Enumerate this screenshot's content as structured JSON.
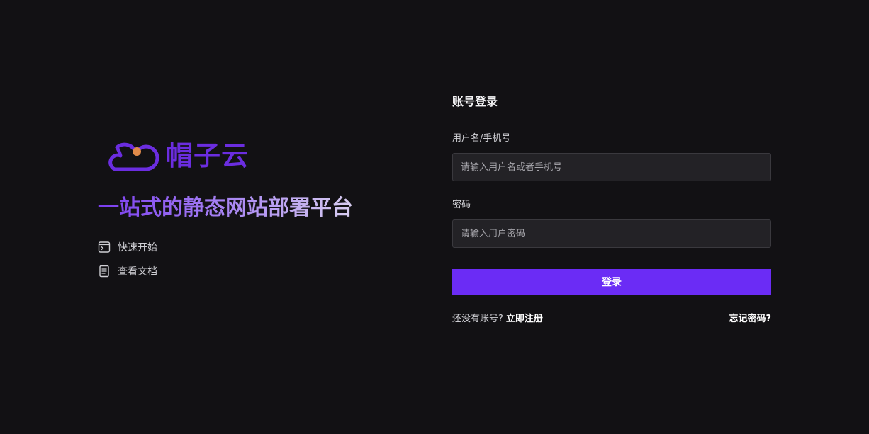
{
  "brand": {
    "logo_text": "帽子云",
    "slogan": "一站式的静态网站部署平台",
    "links": [
      {
        "label": "快速开始",
        "icon": "terminal-icon"
      },
      {
        "label": "查看文档",
        "icon": "document-icon"
      }
    ],
    "colors": {
      "logo": "#6b2de0",
      "logo_dot": "#e08a4a"
    }
  },
  "login": {
    "title": "账号登录",
    "username": {
      "label": "用户名/手机号",
      "placeholder": "请输入用户名或者手机号",
      "value": ""
    },
    "password": {
      "label": "密码",
      "placeholder": "请输入用户密码",
      "value": ""
    },
    "submit_label": "登录",
    "no_account_text": "还没有账号?",
    "register_label": "立即注册",
    "forgot_label": "忘记密码?",
    "colors": {
      "accent": "#6b2cf5",
      "background": "#121114"
    }
  }
}
